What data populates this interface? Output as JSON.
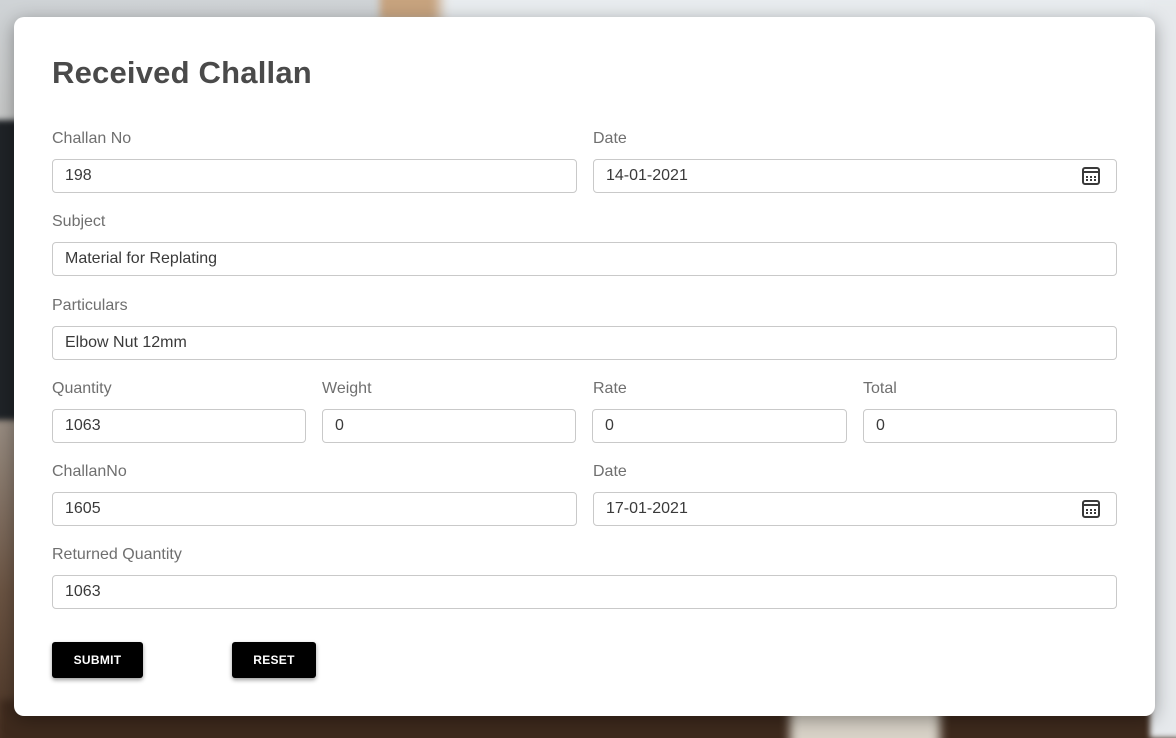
{
  "form": {
    "title": "Received Challan",
    "challan_no": {
      "label": "Challan No",
      "value": "198"
    },
    "date": {
      "label": "Date",
      "value": "14-01-2021"
    },
    "subject": {
      "label": "Subject",
      "value": "Material for Replating"
    },
    "particulars": {
      "label": "Particulars",
      "value": "Elbow Nut 12mm"
    },
    "quantity": {
      "label": "Quantity",
      "value": "1063"
    },
    "weight": {
      "label": "Weight",
      "value": "0"
    },
    "rate": {
      "label": "Rate",
      "value": "0"
    },
    "total": {
      "label": "Total",
      "value": "0"
    },
    "return_challan_no": {
      "label": "ChallanNo",
      "value": "1605"
    },
    "return_date": {
      "label": "Date",
      "value": "17-01-2021"
    },
    "returned_quantity": {
      "label": "Returned Quantity",
      "value": "1063"
    },
    "buttons": {
      "submit": "SUBMIT",
      "reset": "RESET"
    }
  },
  "icons": {
    "calendar": "calendar-icon"
  },
  "colors": {
    "button_bg": "#000000",
    "button_text": "#ffffff",
    "title": "#4a4a4a"
  }
}
